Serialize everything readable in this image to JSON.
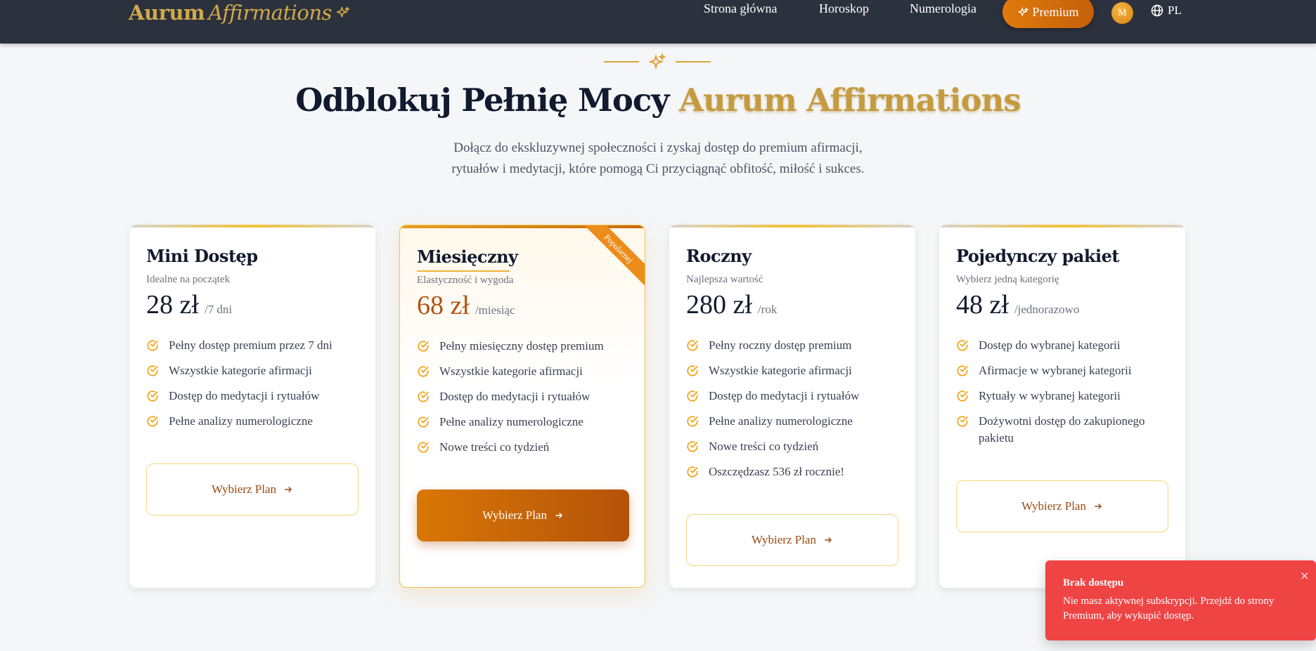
{
  "brand": {
    "name_primary": "Aurum",
    "name_secondary": "Affirmations",
    "color": "#d1a94a"
  },
  "nav": {
    "links": [
      "Strona główna",
      "Horoskop",
      "Numerologia"
    ],
    "premium_label": "Premium",
    "avatar_initial": "M",
    "language": "PL"
  },
  "hero": {
    "title_main": "Odblokuj Pełnię Mocy",
    "title_highlight": "Aurum Affirmations",
    "subtitle_line1": "Dołącz do ekskluzywnej społeczności i zyskaj dostęp do premium afirmacji,",
    "subtitle_line2": "rytuałów i medytacji, które pomogą Ci przyciągnąć obfitość, miłość i sukces."
  },
  "plans": [
    {
      "name": "Mini Dostęp",
      "desc": "Idealne na początek",
      "price": "28 zł",
      "period": "/7 dni",
      "features": [
        "Pełny dostęp premium przez 7 dni",
        "Wszystkie kategorie afirmacji",
        "Dostęp do medytacji i rytuałów",
        "Pełne analizy numerologiczne"
      ],
      "button": "Wybierz Plan"
    },
    {
      "name": "Miesięczny",
      "desc": "Elastyczność i wygoda",
      "price": "68 zł",
      "period": "/miesiąc",
      "badge": "Popularnej",
      "features": [
        "Pełny miesięczny dostęp premium",
        "Wszystkie kategorie afirmacji",
        "Dostęp do medytacji i rytuałów",
        "Pełne analizy numerologiczne",
        "Nowe treści co tydzień"
      ],
      "button": "Wybierz Plan"
    },
    {
      "name": "Roczny",
      "desc": "Najlepsza wartość",
      "price": "280 zł",
      "period": "/rok",
      "features": [
        "Pełny roczny dostęp premium",
        "Wszystkie kategorie afirmacji",
        "Dostęp do medytacji i rytuałów",
        "Pełne analizy numerologiczne",
        "Nowe treści co tydzień",
        "Oszczędzasz 536 zł rocznie!"
      ],
      "button": "Wybierz Plan"
    },
    {
      "name": "Pojedynczy pakiet",
      "desc": "Wybierz jedną kategorię",
      "price": "48 zł",
      "period": "/jednorazowo",
      "features": [
        "Dostęp do wybranej kategorii",
        "Afirmacje w wybranej kategorii",
        "Rytuały w wybranej kategorii",
        "Dożywotni dostęp do zakupionego pakietu"
      ],
      "button": "Wybierz Plan"
    }
  ],
  "toast": {
    "title": "Brak dostępu",
    "message": "Nie masz aktywnej subskrypcji. Przejdź do strony Premium, aby wykupić dostęp.",
    "close": "×",
    "color": "#ef4444"
  },
  "colors": {
    "accent": "#e0a23a",
    "primary_button": "#d97706",
    "navbar": "#2b313d"
  }
}
